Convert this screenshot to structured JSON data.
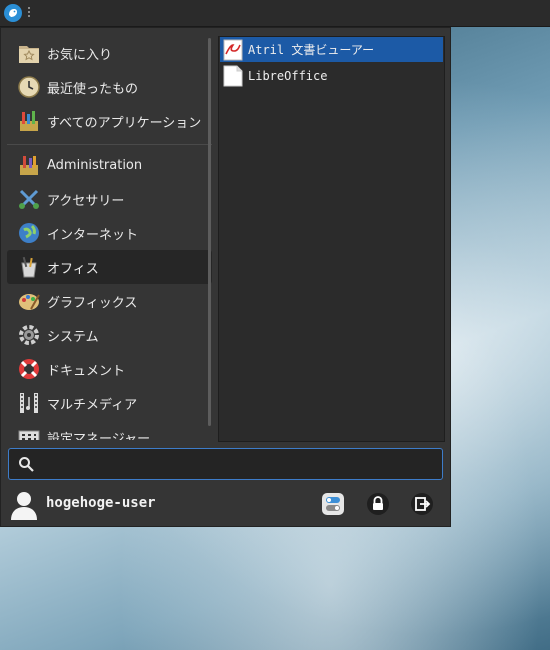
{
  "panel": {
    "menu_icon": "whisker-menu-icon"
  },
  "categories": [
    {
      "label": "お気に入り",
      "icon": "favorites-icon"
    },
    {
      "label": "最近使ったもの",
      "icon": "recent-icon"
    },
    {
      "label": "すべてのアプリケーション",
      "icon": "all-apps-icon"
    },
    {
      "label": "Administration",
      "icon": "administration-icon"
    },
    {
      "label": "アクセサリー",
      "icon": "accessories-icon"
    },
    {
      "label": "インターネット",
      "icon": "internet-icon"
    },
    {
      "label": "オフィス",
      "icon": "office-icon"
    },
    {
      "label": "グラフィックス",
      "icon": "graphics-icon"
    },
    {
      "label": "システム",
      "icon": "system-icon"
    },
    {
      "label": "ドキュメント",
      "icon": "documentation-icon"
    },
    {
      "label": "マルチメディア",
      "icon": "multimedia-icon"
    },
    {
      "label": "設定マネージャー",
      "icon": "settings-manager-icon"
    }
  ],
  "apps": [
    {
      "label": "Atril 文書ビューアー",
      "icon": "atril-icon"
    },
    {
      "label": "LibreOffice",
      "icon": "libreoffice-icon"
    }
  ],
  "search": {
    "placeholder": "",
    "value": ""
  },
  "user": {
    "name": "hogehoge-user"
  },
  "actions": [
    {
      "icon": "settings-toggle-icon"
    },
    {
      "icon": "lock-icon"
    },
    {
      "icon": "logout-icon"
    }
  ],
  "colors": {
    "accent": "#1c5aa6",
    "panel_bg": "#2b2b2b",
    "menu_bg": "#353535"
  }
}
